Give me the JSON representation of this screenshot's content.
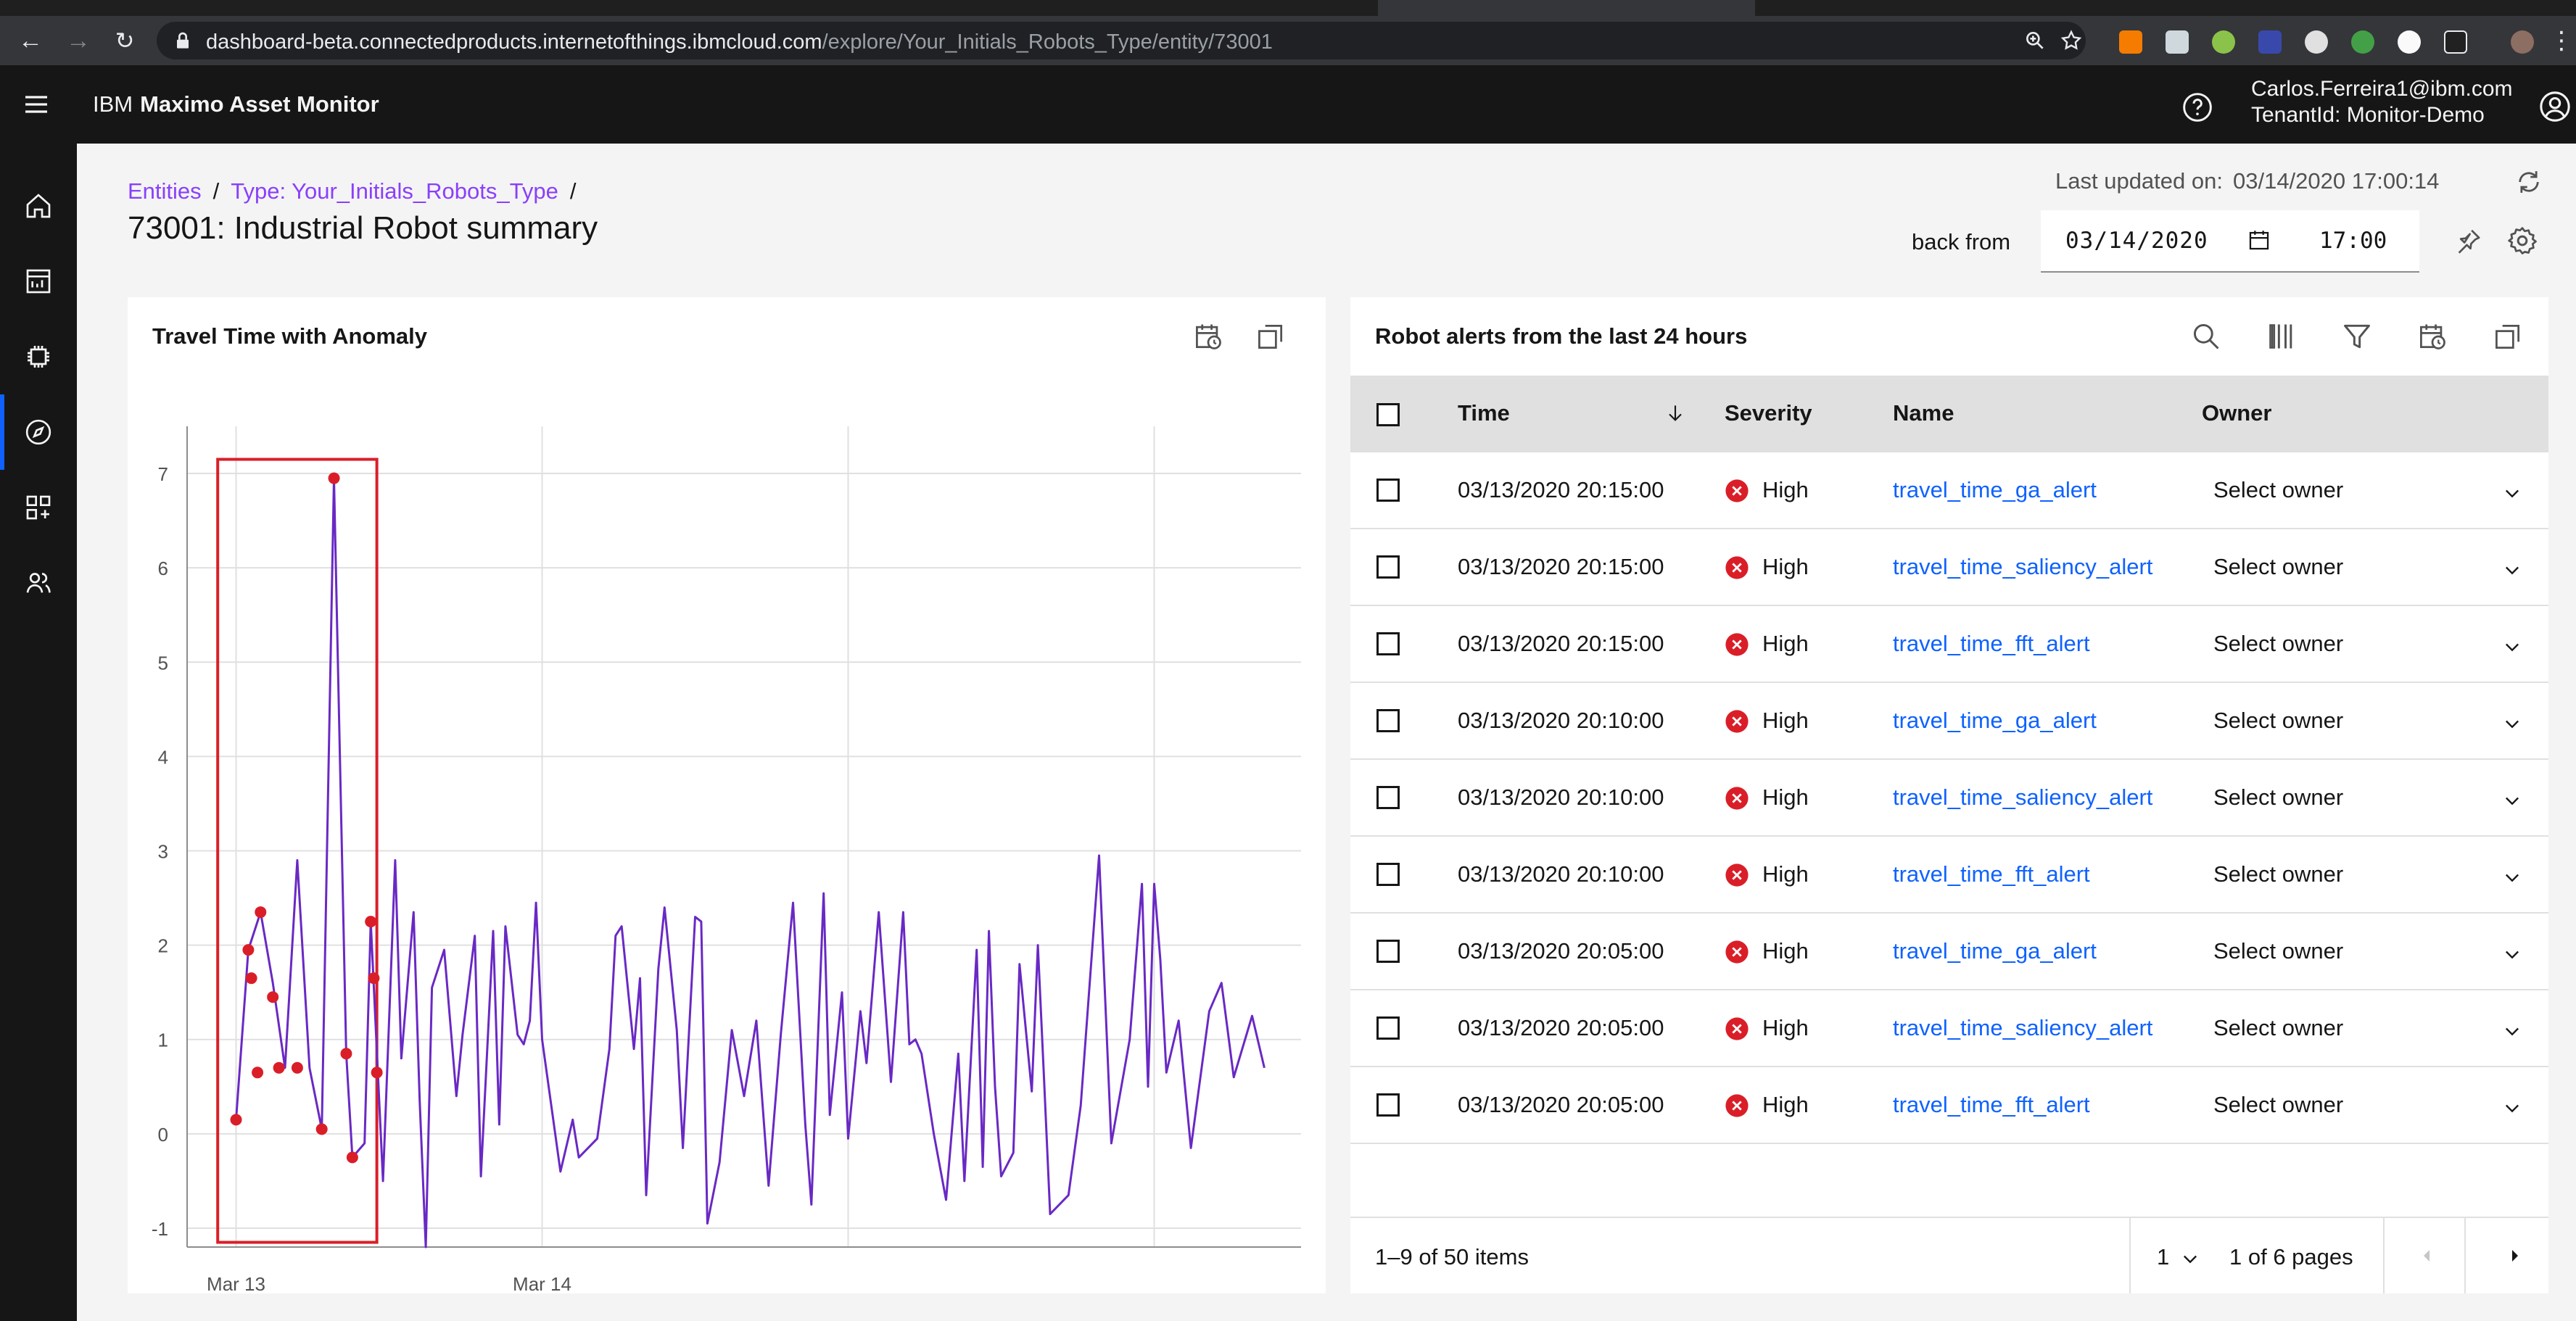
{
  "browser": {
    "url_host": "dashboard-beta.connectedproducts.internetofthings.ibmcloud.com",
    "url_path": "/explore/Your_Initials_Robots_Type/entity/73001"
  },
  "app": {
    "brand_prefix": "IBM",
    "brand_name": "Maximo Asset Monitor",
    "user_email": "Carlos.Ferreira1@ibm.com",
    "tenant": "TenantId: Monitor-Demo",
    "nav_icons": [
      "home-icon",
      "dashboard-icon",
      "device-icon",
      "explore-icon",
      "apps-icon",
      "users-icon"
    ]
  },
  "page": {
    "breadcrumb": [
      "Entities",
      "Type: Your_Initials_Robots_Type"
    ],
    "breadcrumb_sep": "/",
    "title": "73001: Industrial Robot summary",
    "last_updated_label": "Last updated on:",
    "last_updated_value": "03/14/2020 17:00:14",
    "back_from_label": "back from",
    "date": "03/14/2020",
    "time": "17:00"
  },
  "chart_card": {
    "title": "Travel Time with Anomaly"
  },
  "chart_data": {
    "type": "line",
    "title": "Travel Time with Anomaly",
    "xlabel": "",
    "ylabel": "",
    "ylim": [
      -1.2,
      7.5
    ],
    "yticks": [
      -1,
      0,
      1,
      2,
      3,
      4,
      5,
      6,
      7
    ],
    "xlim": [
      0,
      1.82
    ],
    "xtick_positions": [
      0.08,
      0.58
    ],
    "xticks": [
      "Mar 13",
      "Mar 14"
    ],
    "grid": true,
    "series": [
      {
        "values": [
          [
            0.08,
            0.15
          ],
          [
            0.1,
            1.95
          ],
          [
            0.12,
            2.35
          ],
          [
            0.14,
            1.6
          ],
          [
            0.16,
            0.7
          ],
          [
            0.18,
            2.9
          ],
          [
            0.2,
            0.7
          ],
          [
            0.22,
            0.05
          ],
          [
            0.24,
            6.95
          ],
          [
            0.26,
            0.85
          ],
          [
            0.27,
            -0.25
          ],
          [
            0.29,
            -0.1
          ],
          [
            0.3,
            2.25
          ],
          [
            0.32,
            -0.5
          ],
          [
            0.34,
            2.9
          ],
          [
            0.35,
            0.8
          ],
          [
            0.37,
            2.35
          ],
          [
            0.38,
            0.35
          ],
          [
            0.39,
            -1.2
          ],
          [
            0.4,
            1.55
          ],
          [
            0.42,
            1.95
          ],
          [
            0.44,
            0.4
          ],
          [
            0.45,
            1.05
          ],
          [
            0.47,
            2.1
          ],
          [
            0.48,
            -0.45
          ],
          [
            0.5,
            2.15
          ],
          [
            0.51,
            0.1
          ],
          [
            0.52,
            2.2
          ],
          [
            0.54,
            1.05
          ],
          [
            0.55,
            0.95
          ],
          [
            0.56,
            1.2
          ],
          [
            0.57,
            2.45
          ],
          [
            0.58,
            1.0
          ],
          [
            0.61,
            -0.4
          ],
          [
            0.63,
            0.15
          ],
          [
            0.64,
            -0.25
          ],
          [
            0.67,
            -0.05
          ],
          [
            0.69,
            0.9
          ],
          [
            0.7,
            2.1
          ],
          [
            0.71,
            2.2
          ],
          [
            0.73,
            0.9
          ],
          [
            0.74,
            1.65
          ],
          [
            0.75,
            -0.65
          ],
          [
            0.77,
            1.75
          ],
          [
            0.78,
            2.4
          ],
          [
            0.8,
            1.1
          ],
          [
            0.81,
            -0.15
          ],
          [
            0.83,
            2.3
          ],
          [
            0.84,
            2.25
          ],
          [
            0.85,
            -0.95
          ],
          [
            0.87,
            -0.3
          ],
          [
            0.89,
            1.1
          ],
          [
            0.91,
            0.4
          ],
          [
            0.93,
            1.2
          ],
          [
            0.95,
            -0.55
          ],
          [
            0.97,
            1.05
          ],
          [
            0.99,
            2.45
          ],
          [
            1.01,
            0.1
          ],
          [
            1.02,
            -0.75
          ],
          [
            1.04,
            2.55
          ],
          [
            1.05,
            0.2
          ],
          [
            1.07,
            1.5
          ],
          [
            1.08,
            -0.05
          ],
          [
            1.1,
            1.3
          ],
          [
            1.11,
            0.75
          ],
          [
            1.13,
            2.35
          ],
          [
            1.15,
            0.55
          ],
          [
            1.17,
            2.35
          ],
          [
            1.18,
            0.95
          ],
          [
            1.19,
            1.0
          ],
          [
            1.2,
            0.85
          ],
          [
            1.22,
            0.0
          ],
          [
            1.24,
            -0.7
          ],
          [
            1.26,
            0.85
          ],
          [
            1.27,
            -0.5
          ],
          [
            1.29,
            1.95
          ],
          [
            1.3,
            -0.35
          ],
          [
            1.31,
            2.15
          ],
          [
            1.32,
            0.5
          ],
          [
            1.33,
            -0.45
          ],
          [
            1.35,
            -0.2
          ],
          [
            1.36,
            1.8
          ],
          [
            1.38,
            0.45
          ],
          [
            1.39,
            2.0
          ],
          [
            1.4,
            0.6
          ],
          [
            1.41,
            -0.85
          ],
          [
            1.44,
            -0.65
          ],
          [
            1.46,
            0.3
          ],
          [
            1.49,
            2.95
          ],
          [
            1.51,
            -0.1
          ],
          [
            1.54,
            1.0
          ],
          [
            1.56,
            2.65
          ],
          [
            1.57,
            0.5
          ],
          [
            1.58,
            2.65
          ],
          [
            1.59,
            1.85
          ],
          [
            1.6,
            0.65
          ],
          [
            1.62,
            1.2
          ],
          [
            1.64,
            -0.15
          ],
          [
            1.67,
            1.3
          ],
          [
            1.69,
            1.6
          ],
          [
            1.71,
            0.6
          ],
          [
            1.74,
            1.25
          ],
          [
            1.76,
            0.7
          ]
        ]
      }
    ],
    "anomaly_points": [
      [
        0.08,
        0.15
      ],
      [
        0.1,
        1.95
      ],
      [
        0.105,
        1.65
      ],
      [
        0.115,
        0.65
      ],
      [
        0.12,
        2.35
      ],
      [
        0.14,
        1.45
      ],
      [
        0.15,
        0.7
      ],
      [
        0.18,
        0.7
      ],
      [
        0.22,
        0.05
      ],
      [
        0.24,
        6.95
      ],
      [
        0.26,
        0.85
      ],
      [
        0.27,
        -0.25
      ],
      [
        0.3,
        2.25
      ],
      [
        0.305,
        1.65
      ],
      [
        0.31,
        0.65
      ]
    ],
    "anomaly_window": {
      "x": [
        0.05,
        0.31
      ],
      "y": [
        -1.15,
        7.15
      ]
    },
    "colors": {
      "line": "#6929c4",
      "anomaly": "#da1e28",
      "window": "#da1e28",
      "grid": "#e0e0e0"
    }
  },
  "alerts_card": {
    "title": "Robot alerts from the last 24 hours",
    "columns": {
      "time": "Time",
      "severity": "Severity",
      "name": "Name",
      "owner": "Owner"
    },
    "rows": [
      {
        "time": "03/13/2020 20:15:00",
        "severity": "High",
        "name": "travel_time_ga_alert",
        "owner": "Select owner"
      },
      {
        "time": "03/13/2020 20:15:00",
        "severity": "High",
        "name": "travel_time_saliency_alert",
        "owner": "Select owner"
      },
      {
        "time": "03/13/2020 20:15:00",
        "severity": "High",
        "name": "travel_time_fft_alert",
        "owner": "Select owner"
      },
      {
        "time": "03/13/2020 20:10:00",
        "severity": "High",
        "name": "travel_time_ga_alert",
        "owner": "Select owner"
      },
      {
        "time": "03/13/2020 20:10:00",
        "severity": "High",
        "name": "travel_time_saliency_alert",
        "owner": "Select owner"
      },
      {
        "time": "03/13/2020 20:10:00",
        "severity": "High",
        "name": "travel_time_fft_alert",
        "owner": "Select owner"
      },
      {
        "time": "03/13/2020 20:05:00",
        "severity": "High",
        "name": "travel_time_ga_alert",
        "owner": "Select owner"
      },
      {
        "time": "03/13/2020 20:05:00",
        "severity": "High",
        "name": "travel_time_saliency_alert",
        "owner": "Select owner"
      },
      {
        "time": "03/13/2020 20:05:00",
        "severity": "High",
        "name": "travel_time_fft_alert",
        "owner": "Select owner"
      }
    ],
    "pager": {
      "items": "1–9 of 50 items",
      "page": "1",
      "of_pages": "1 of 6 pages"
    },
    "severity_color": "#da1e28"
  }
}
